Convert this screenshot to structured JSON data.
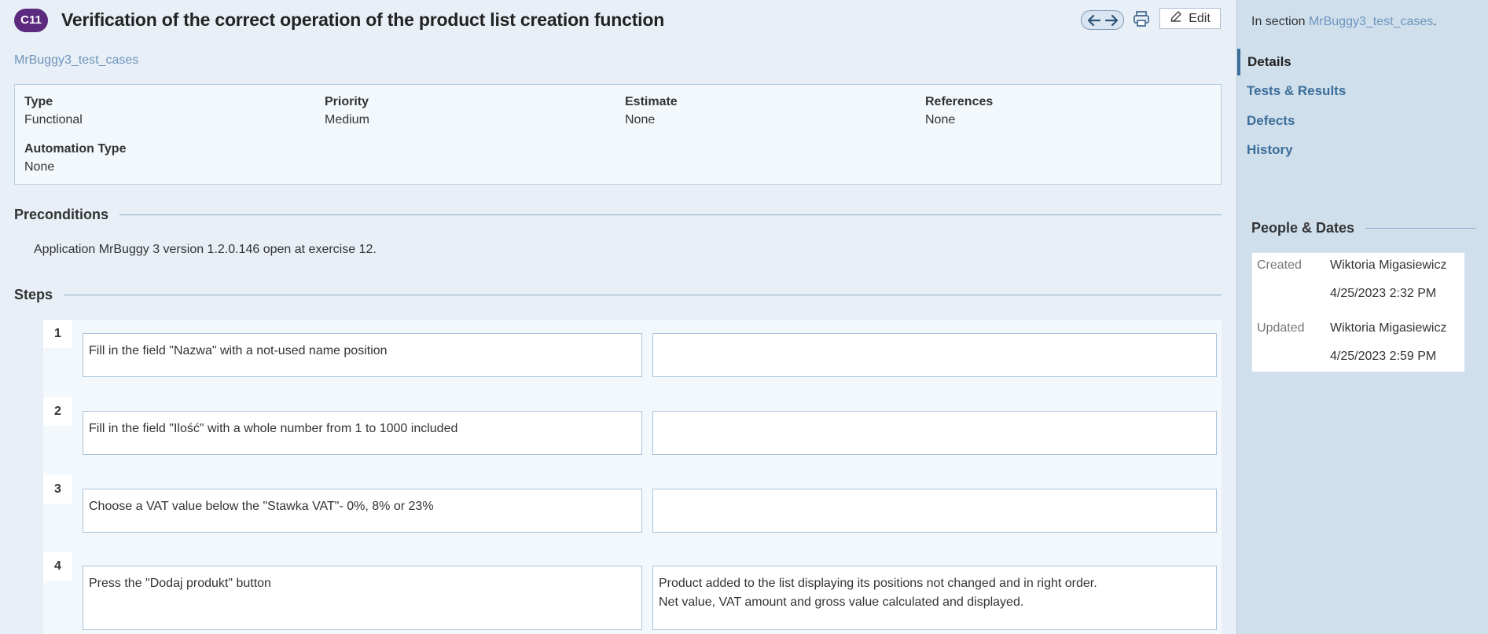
{
  "header": {
    "case_id": "C11",
    "title": "Verification of the correct operation of the product list creation function",
    "edit_label": "Edit",
    "section_link": "MrBuggy3_test_cases"
  },
  "details": {
    "type_label": "Type",
    "type_value": "Functional",
    "priority_label": "Priority",
    "priority_value": "Medium",
    "estimate_label": "Estimate",
    "estimate_value": "None",
    "references_label": "References",
    "references_value": "None",
    "automation_label": "Automation Type",
    "automation_value": "None"
  },
  "preconditions": {
    "heading": "Preconditions",
    "text": "Application MrBuggy 3 version 1.2.0.146 open at exercise 12."
  },
  "steps": {
    "heading": "Steps",
    "items": [
      {
        "num": "1",
        "action": "Fill in the field \"Nazwa\" with a not-used name position",
        "expected": ""
      },
      {
        "num": "2",
        "action": "Fill in the field \"Ilość\" with a whole number from 1 to 1000 included",
        "expected": ""
      },
      {
        "num": "3",
        "action": "Choose a VAT value below the \"Stawka VAT\"- 0%, 8% or 23%",
        "expected": ""
      },
      {
        "num": "4",
        "action": "Press the \"Dodaj produkt\" button",
        "expected_line1": "Product added to the list displaying its positions not changed and in right order.",
        "expected_line2": "Net value, VAT amount and gross value calculated and displayed."
      }
    ]
  },
  "sidebar": {
    "in_section_prefix": "In section ",
    "in_section_link": "MrBuggy3_test_cases",
    "in_section_suffix": ".",
    "nav": [
      "Details",
      "Tests & Results",
      "Defects",
      "History"
    ],
    "people_dates": {
      "heading": "People & Dates",
      "created_label": "Created",
      "created_by": "Wiktoria Migasiewicz",
      "created_at": "4/25/2023 2:32 PM",
      "updated_label": "Updated",
      "updated_by": "Wiktoria Migasiewicz",
      "updated_at": "4/25/2023 2:59 PM"
    }
  },
  "colors": {
    "badge": "#5b2a7e",
    "link": "#6e95bd",
    "nav": "#3c6e9a"
  },
  "icons": [
    "arrow-left-icon",
    "arrow-right-icon",
    "printer-icon",
    "pencil-icon"
  ]
}
